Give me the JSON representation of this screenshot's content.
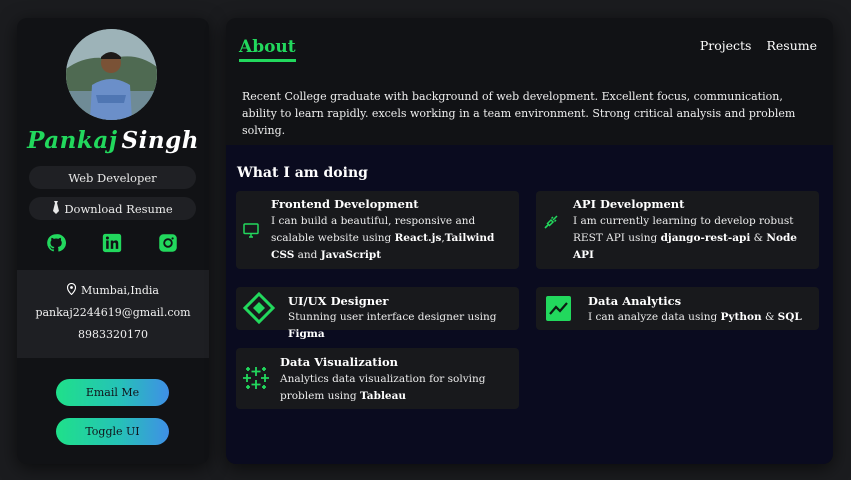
{
  "profile": {
    "first_name": "Pankaj",
    "last_name": "Singh",
    "role": "Web Developer",
    "download_label": "Download Resume"
  },
  "socials": {
    "github_icon": "github-icon",
    "linkedin_icon": "linkedin-icon",
    "instagram_icon": "instagram-icon"
  },
  "contact": {
    "location": "Mumbai,India",
    "email": "pankaj2244619@gmail.com",
    "phone": "8983320170"
  },
  "buttons": {
    "email": "Email Me",
    "toggle": "Toggle UI"
  },
  "header": {
    "about": "About",
    "nav": [
      "Projects",
      "Resume"
    ]
  },
  "about_text": "Recent College graduate with background of web development. Excellent focus, communication, ability to learn rapidly. excels working in a team environment. Strong critical analysis and problem solving.",
  "doing": {
    "title": "What I am doing",
    "cards": [
      {
        "title": "Frontend Development",
        "desc_pre": "I can build a beautiful, responsive and scalable website using ",
        "b1": "React.js",
        "mid": ",",
        "b2": "Tailwind CSS",
        "mid2": " and ",
        "b3": "JavaScript",
        "icon": "monitor-icon"
      },
      {
        "title": "API Development",
        "desc_pre": "I am currently learning to develop robust REST API using ",
        "b1": "django-rest-api",
        "mid": " & ",
        "b2": "Node API",
        "icon": "plug-icon"
      },
      {
        "title": "UI/UX Designer",
        "desc_pre": "Stunning user interface designer using ",
        "b1": "Figma",
        "icon": "diamond-icon"
      },
      {
        "title": "Data Analytics",
        "desc_pre": "I can analyze data using ",
        "b1": "Python",
        "mid": " & ",
        "b2": "SQL",
        "icon": "trend-icon"
      },
      {
        "title": "Data Visualization",
        "desc_pre": "Analytics data visualization for solving problem using ",
        "b1": "Tableau",
        "icon": "tableau-icon"
      }
    ]
  },
  "colors": {
    "accent": "#22d85d",
    "panel": "#111215",
    "card": "#18191c",
    "doing_bg": "#0a0b1f"
  }
}
